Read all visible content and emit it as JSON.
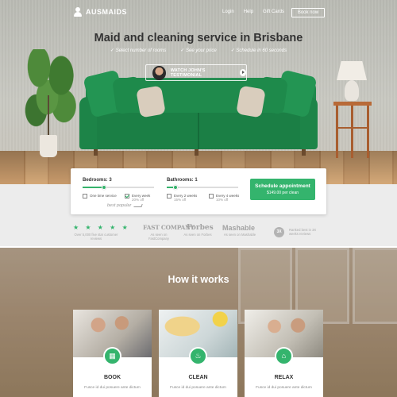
{
  "nav": {
    "logo": "AUSMAIDS",
    "links": [
      "Login",
      "Help",
      "Gift Cards"
    ],
    "book_now": "Book now"
  },
  "hero": {
    "title": "Maid and cleaning service in Brisbane",
    "features": [
      "Select number of rooms",
      "See your price",
      "Schedule in 60 seconds"
    ],
    "testimonial_label": "WATCH JOHN'S TESTIMONIAL"
  },
  "booking": {
    "bedrooms_label": "Bedrooms: 3",
    "bedrooms_level": 0.3,
    "bathrooms_label": "Bathrooms: 1",
    "bathrooms_level": 0.12,
    "options": [
      {
        "label": "One time service",
        "sub": "",
        "checked": false
      },
      {
        "label": "Every week",
        "sub": "20% off",
        "checked": true
      },
      {
        "label": "Every 2 weeks",
        "sub": "15% off",
        "checked": false
      },
      {
        "label": "Every 4 weeks",
        "sub": "10% off",
        "checked": false
      }
    ],
    "schedule_label": "Schedule appointment",
    "schedule_price": "$149.00 per clean",
    "best_popular": "best popular"
  },
  "trust": {
    "stars": "★ ★ ★ ★ ★",
    "stars_caption": "Over 5,000 five star customer reviews",
    "fast_company": "FAST COMPANY",
    "fast_caption": "As seen on FastCompany",
    "forbes": "Forbes",
    "forbes_caption": "As seen on Forbes",
    "mashable": "Mashable",
    "mashable_caption": "As seen on Mashable",
    "badge": "3X",
    "badge_caption": "Ranked best in 3X weeks reviews"
  },
  "how": {
    "title": "How it works",
    "cards": [
      {
        "title": "BOOK",
        "icon": "calendar-icon",
        "text": "Fusce id dui posuere ante dictum"
      },
      {
        "title": "CLEAN",
        "icon": "spray-bottle-icon",
        "text": "Fusce id dui posuere ante dictum"
      },
      {
        "title": "RELAX",
        "icon": "sofa-icon",
        "text": "Fusce id dui posuere ante dictum"
      }
    ]
  },
  "colors": {
    "accent": "#34b46d",
    "sofa": "#1f8a4c"
  }
}
